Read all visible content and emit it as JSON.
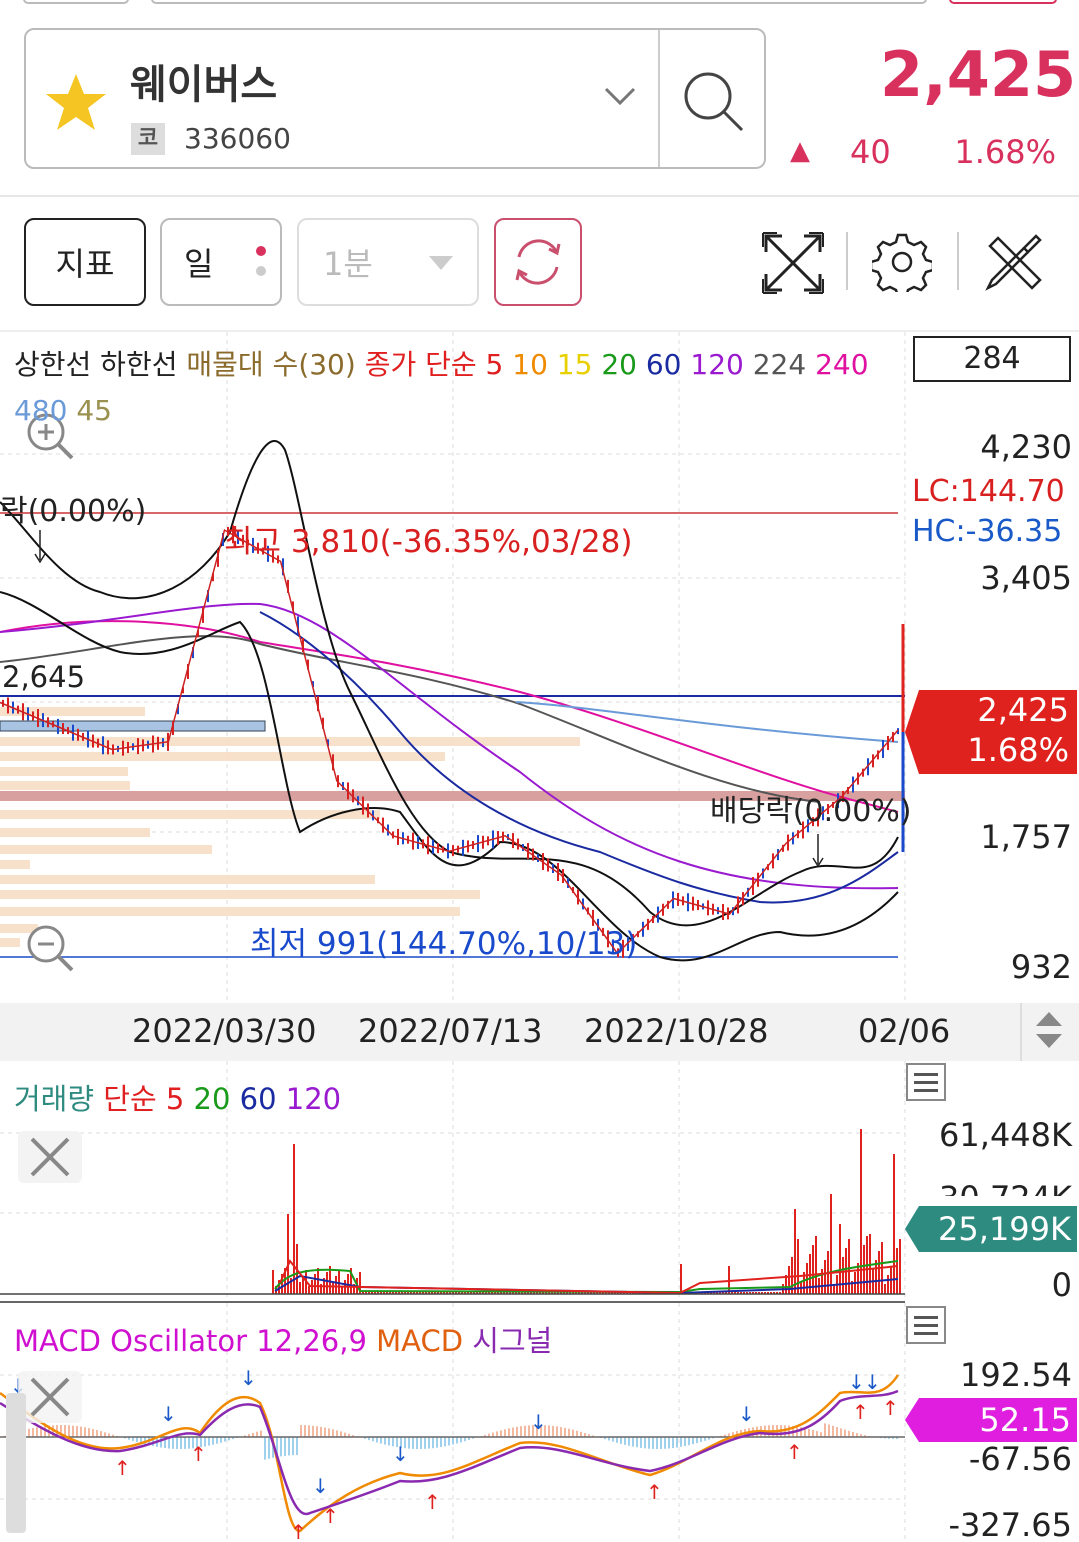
{
  "stock": {
    "name": "웨이버스",
    "market_badge": "코",
    "code": "336060",
    "price": "2,425",
    "change_arrow": "▲",
    "change": "40",
    "change_pct": "1.68%",
    "colors": {
      "up": "#d9315e"
    }
  },
  "toolbar": {
    "indicator_btn": "지표",
    "period_btn": "일",
    "minute_select": "1분"
  },
  "chart": {
    "legend": [
      {
        "text": "상한선 하한선",
        "color": "#222"
      },
      {
        "text": "매물대 수(30)",
        "color": "#8a6b2c"
      },
      {
        "text": "종가 단순",
        "color": "#e02020"
      },
      {
        "text": "5",
        "color": "#e02020"
      },
      {
        "text": "10",
        "color": "#f08a00"
      },
      {
        "text": "15",
        "color": "#e8d000"
      },
      {
        "text": "20",
        "color": "#1a9a1a"
      },
      {
        "text": "60",
        "color": "#1a2aa0"
      },
      {
        "text": "120",
        "color": "#9a1ad0"
      },
      {
        "text": "224",
        "color": "#555"
      },
      {
        "text": "240",
        "color": "#e010a0"
      },
      {
        "text": "480",
        "color": "#6a9ad8"
      },
      {
        "text": "45",
        "color": "#9a9050"
      }
    ],
    "count": "284",
    "y_labels": [
      "4,230",
      "3,405",
      "1,757",
      "932"
    ],
    "lc": "LC:144.70",
    "hc": "HC:-36.35",
    "level_label": "2,645",
    "high_note": "최고 3,810(-36.35%,03/28)",
    "low_note": "최저 991(144.70%,10/13)",
    "ex_div_left": "락(0.00%)",
    "ex_div_right": "배당락(0.00%)",
    "badge_price": "2,425",
    "badge_pct": "1.68%",
    "dates": [
      "2022/03/30",
      "2022/07/13",
      "2022/10/28",
      "02/06"
    ]
  },
  "volume": {
    "legend_title": "거래량",
    "legend_simple": "단순",
    "ma": [
      "5",
      "20",
      "60",
      "120"
    ],
    "y_top": "61,448K",
    "y_mid": "30,724K",
    "y_zero": "0",
    "badge": "25,199K"
  },
  "macd": {
    "legend_osc": "MACD Oscillator 12,26,9",
    "legend_macd": "MACD",
    "legend_signal": "시그널",
    "y_labels": [
      "192.54",
      "-67.56",
      "-327.65"
    ],
    "badge": "52.15"
  },
  "chart_data": {
    "type": "line",
    "title": "",
    "x": [
      "2022/03/30",
      "2022/07/13",
      "2022/10/28",
      "02/06"
    ],
    "series": [
      {
        "name": "종가",
        "values": [
          2600,
          2450,
          2300,
          2350,
          3700,
          3500,
          2100,
          1750,
          1650,
          1750,
          1500,
          1000,
          1350,
          1250,
          1700,
          2000,
          2425
        ]
      }
    ],
    "ylim": [
      932,
      4230
    ],
    "xlabel": "",
    "ylabel": ""
  }
}
